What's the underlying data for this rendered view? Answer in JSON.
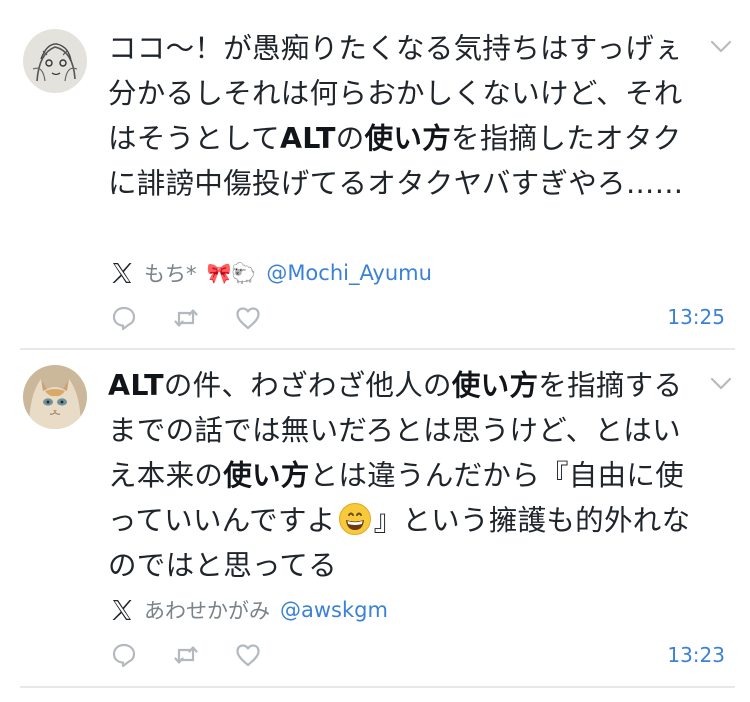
{
  "tweets": [
    {
      "avatar": "sketch-avatar",
      "text_segments": [
        "ココ〜！が愚痴りたくなる気持ちはすっげぇ分かるしそれは何らおかしくないけど、それはそうとして",
        "ALT",
        "の",
        "使い方",
        "を指摘したオタクに誹謗中傷投げてるオタクヤバすぎやろ……"
      ],
      "author_name": "もち*",
      "author_emojis": "🎀🐑",
      "handle": "@Mochi_Ayumu",
      "time": "13:25"
    },
    {
      "avatar": "cat-avatar",
      "text_segments": [
        "ALT",
        "の件、わざわざ他人の",
        "使い方",
        "を指摘するまでの話では無いだろとは思うけど、とはいえ本来の",
        "使い方",
        "とは違うんだから『自由に使っていいんですよ",
        "』という擁護も的外れなのではと思ってる"
      ],
      "author_name": "あわせかがみ",
      "handle": "@awskgm",
      "time": "13:23"
    }
  ],
  "icons": [
    "x-logo-icon",
    "reply-icon",
    "retweet-icon",
    "like-icon",
    "chevron-down-icon",
    "grinning-face-icon"
  ]
}
